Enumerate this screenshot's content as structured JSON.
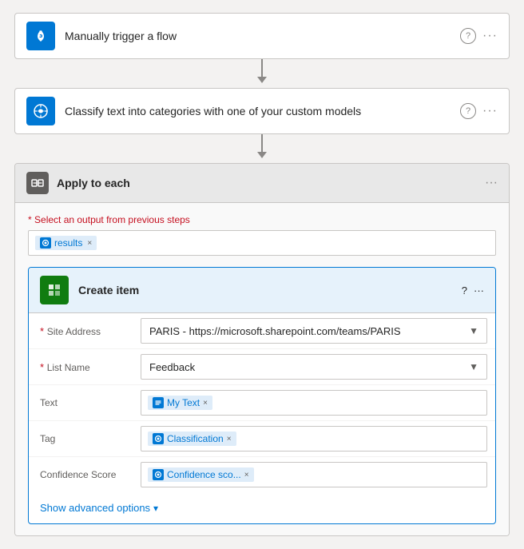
{
  "steps": {
    "trigger": {
      "title": "Manually trigger a flow",
      "icon": "hand",
      "help": "?",
      "more": "···"
    },
    "classify": {
      "title": "Classify text into categories with one of your custom models",
      "icon": "brain",
      "help": "?",
      "more": "···"
    }
  },
  "apply_each": {
    "header_title": "Apply to each",
    "more": "···",
    "select_label": "* Select an output from previous steps",
    "token_results": "results",
    "create_item": {
      "header_title": "Create item",
      "help": "?",
      "more": "···",
      "site_address_label": "* Site Address",
      "site_address_value": "PARIS - https://microsoft.sharepoint.com/teams/PARIS",
      "list_name_label": "* List Name",
      "list_name_value": "Feedback",
      "text_label": "Text",
      "text_token": "My Text",
      "tag_label": "Tag",
      "tag_token": "Classification",
      "confidence_label": "Confidence Score",
      "confidence_token": "Confidence sco...",
      "show_advanced": "Show advanced options"
    }
  }
}
